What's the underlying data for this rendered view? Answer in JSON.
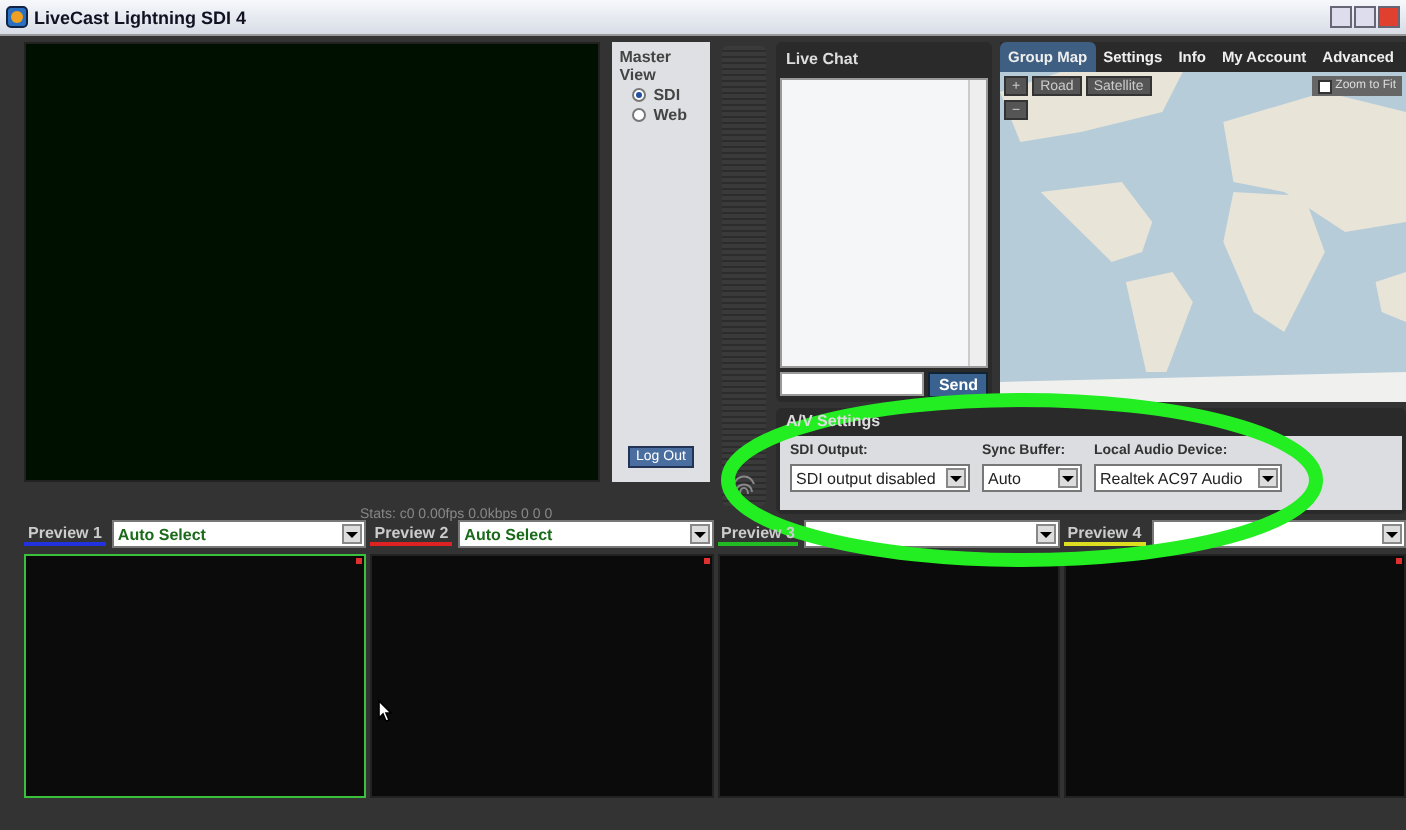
{
  "window": {
    "title": "LiveCast Lightning SDI 4"
  },
  "master_view": {
    "title": "Master View",
    "options": [
      {
        "label": "SDI",
        "selected": true
      },
      {
        "label": "Web",
        "selected": false
      }
    ],
    "logout_button": "Log Out"
  },
  "stats": "Stats: c0 0.00fps 0.0kbps 0 0 0",
  "live_chat": {
    "title": "Live Chat",
    "send_button": "Send"
  },
  "tabs": [
    {
      "label": "Group Map",
      "selected": true
    },
    {
      "label": "Settings",
      "selected": false
    },
    {
      "label": "Info",
      "selected": false
    },
    {
      "label": "My Account",
      "selected": false
    },
    {
      "label": "Advanced",
      "selected": false
    }
  ],
  "map": {
    "zoom_in": "+",
    "zoom_out": "−",
    "modes": [
      "Road",
      "Satellite"
    ],
    "zoom_to_fit": {
      "label": "Zoom to Fit",
      "checked": false
    }
  },
  "av_settings": {
    "title": "A/V Settings",
    "fields": [
      {
        "label": "SDI Output:",
        "value": "SDI output disabled"
      },
      {
        "label": "Sync Buffer:",
        "value": "Auto"
      },
      {
        "label": "Local Audio Device:",
        "value": "Realtek AC97 Audio"
      }
    ]
  },
  "previews": [
    {
      "label": "Preview 1",
      "color": "#2233dd",
      "selected": true,
      "value": "Auto Select"
    },
    {
      "label": "Preview 2",
      "color": "#dd2222",
      "selected": false,
      "value": "Auto Select"
    },
    {
      "label": "Preview 3",
      "color": "#22bb22",
      "selected": false
    },
    {
      "label": "Preview 4",
      "color": "#dddd22",
      "selected": false
    }
  ],
  "annotations": [
    {
      "kind": "ellipse"
    }
  ]
}
